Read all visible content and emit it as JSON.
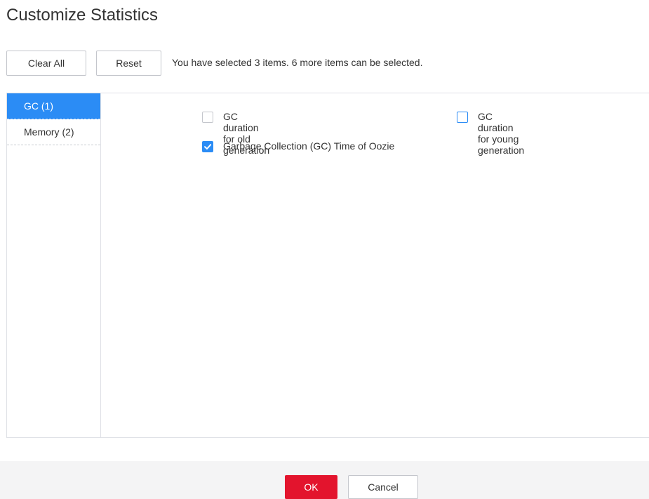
{
  "dialog": {
    "title": "Customize Statistics"
  },
  "toolbar": {
    "clear_all_label": "Clear All",
    "reset_label": "Reset",
    "selection_info": "You have selected 3 items. 6 more items can be selected."
  },
  "categories": [
    {
      "label": "GC (1)",
      "active": true
    },
    {
      "label": "Memory (2)",
      "active": false
    }
  ],
  "options": [
    {
      "label": "GC duration for old generation",
      "checked": false
    },
    {
      "label": "GC duration for young generation",
      "checked": false
    },
    {
      "label": "Garbage Collection (GC) Time of Oozie",
      "checked": true
    }
  ],
  "footer": {
    "ok_label": "OK",
    "cancel_label": "Cancel"
  },
  "colors": {
    "accent": "#2b8cf5",
    "primary_button": "#e3142d",
    "footer_bg": "#f4f4f5"
  },
  "icons": {
    "checked": "checkmark-icon"
  }
}
